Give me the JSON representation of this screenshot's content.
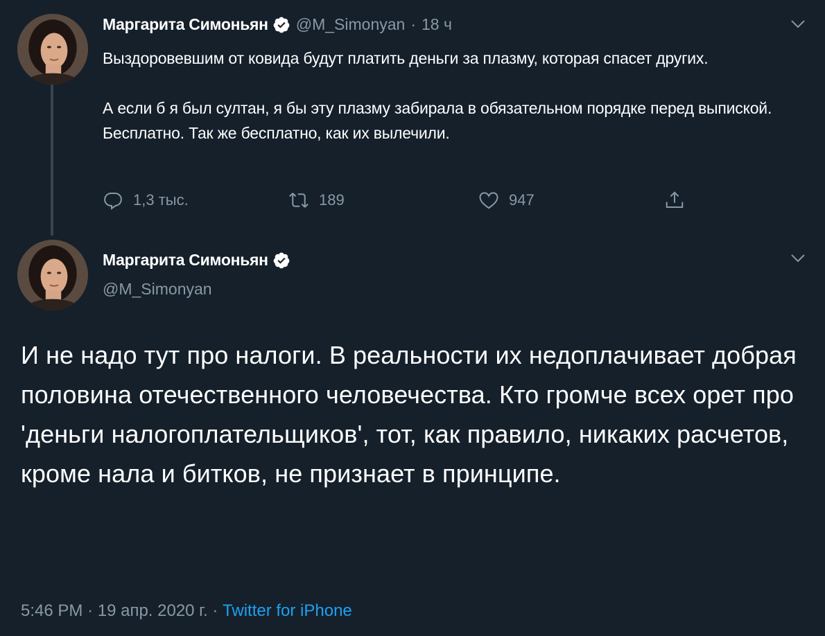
{
  "tweet1": {
    "display_name": "Маргарита Симоньян",
    "handle": "@M_Simonyan",
    "separator": "·",
    "time": "18 ч",
    "text": "Выздоровевшим от ковида будут платить деньги за плазму, которая спасет других.\n\nА если б я был султан, я бы эту плазму забирала в обязательном порядке перед выпиской. Бесплатно. Так же бесплатно, как их вылечили.",
    "actions": {
      "reply_count": "1,3 тыс.",
      "retweet_count": "189",
      "like_count": "947"
    }
  },
  "tweet2": {
    "display_name": "Маргарита Симоньян",
    "handle": "@M_Simonyan",
    "text": "И не надо тут про налоги. В реальности их недоплачивает добрая половина отечественного человечества. Кто громче всех орет про 'деньги налогоплательщиков', тот, как правило, никаких расчетов, кроме нала и битков, не признает в принципе.",
    "time": "5:46 PM",
    "date": "19 апр. 2020 г.",
    "separator": "·",
    "source": "Twitter for iPhone"
  },
  "icons": {
    "verified": "verified-badge-icon",
    "chevron": "chevron-down-icon",
    "reply": "reply-icon",
    "retweet": "retweet-icon",
    "like": "heart-icon",
    "share": "share-icon"
  },
  "colors": {
    "background": "#15202b",
    "text": "#ffffff",
    "secondary": "#8899a6",
    "accent": "#1da1f2",
    "thread_line": "#38444d"
  }
}
